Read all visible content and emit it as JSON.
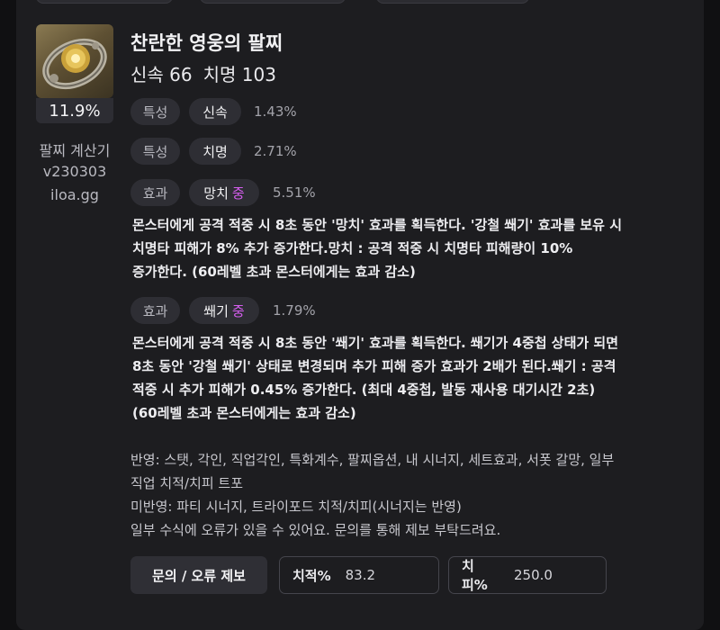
{
  "item": {
    "name": "찬란한 영웅의 팔찌",
    "stats": [
      "신속 66",
      "치명 103"
    ],
    "percent": "11.9%"
  },
  "sidebar": {
    "line1": "팔찌 계산기",
    "line2": "v230303",
    "line3": "iloa.gg"
  },
  "rows": [
    {
      "type": "특성",
      "name": "신속",
      "grade": "",
      "value": "1.43%"
    },
    {
      "type": "특성",
      "name": "치명",
      "grade": "",
      "value": "2.71%"
    },
    {
      "type": "효과",
      "name": "망치",
      "grade": "중",
      "value": "5.51%"
    },
    {
      "type": "효과",
      "name": "쐐기",
      "grade": "중",
      "value": "1.79%"
    }
  ],
  "descriptions": {
    "hammer": [
      "몬스터에게 공격 적중 시 8초 동안 '망치' 효과를 획득한다. '강철 쐐기' 효과를 보유 시",
      "치명타 피해가 8% 추가 증가한다.망치 : 공격 적중 시 치명타 피해량이 10%",
      "증가한다. (60레벨 초과 몬스터에게는 효과 감소)"
    ],
    "wedge": [
      "몬스터에게 공격 적중 시 8초 동안 '쐐기' 효과를 획득한다. 쐐기가 4중첩 상태가 되면",
      "8초 동안 '강철 쐐기' 상태로 변경되며 추가 피해 증가 효과가 2배가 된다.쐐기 : 공격",
      "적중 시 추가 피해가 0.45% 증가한다. (최대 4중첩, 발동 재사용 대기시간 2초)",
      " (60레벨 초과 몬스터에게는 효과 감소)"
    ]
  },
  "notes": [
    "반영: 스탯, 각인, 직업각인, 특화계수, 팔찌옵션, 내 시너지, 세트효과, 서폿 갈망, 일부",
    "직업 치적/치피 트포",
    "미반영: 파티 시너지, 트라이포드 치적/치피(시너지는 반영)",
    "일부 수식에 오류가 있을 수 있어요. 문의를 통해 제보 부탁드려요."
  ],
  "footer": {
    "report_button": "문의 / 오류 제보",
    "crit_rate_label": "치적%",
    "crit_rate_value": "83.2",
    "crit_dmg_label": "치피%",
    "crit_dmg_value": "250.0"
  },
  "colors": {
    "grade": "#d65ef0",
    "card": "#1d1d20",
    "chip": "#2e2e34"
  },
  "icons": {
    "item": "bracelet-icon"
  }
}
